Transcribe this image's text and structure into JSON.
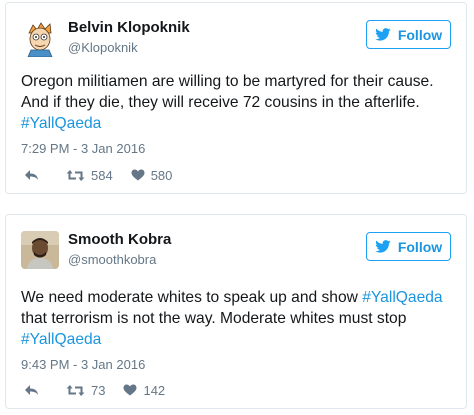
{
  "tweets": [
    {
      "author": {
        "name": "Belvin Klopoknik",
        "handle": "@Klopoknik"
      },
      "follow_label": "Follow",
      "text_before": "Oregon militiamen are willing to be martyred for their cause. And if they die, they will receive 72 cousins in the afterlife. ",
      "hashtag": "#YallQaeda",
      "text_between": "",
      "hashtag2": "",
      "timestamp": "7:29 PM - 3 Jan 2016",
      "retweets": "584",
      "likes": "580"
    },
    {
      "author": {
        "name": "Smooth Kobra",
        "handle": "@smoothkobra"
      },
      "follow_label": "Follow",
      "text_before": "We need moderate whites to speak up and show ",
      "hashtag": "#YallQaeda",
      "text_between": " that terrorism is not the way. Moderate whites must stop ",
      "hashtag2": "#YallQaeda",
      "timestamp": "9:43 PM - 3 Jan 2016",
      "retweets": "73",
      "likes": "142"
    }
  ],
  "colors": {
    "link": "#1b95e0",
    "text": "#14171a",
    "muted": "#657786",
    "border": "#e1e8ed"
  },
  "icons": [
    "twitter-bird-icon",
    "reply-icon",
    "retweet-icon",
    "heart-icon"
  ]
}
